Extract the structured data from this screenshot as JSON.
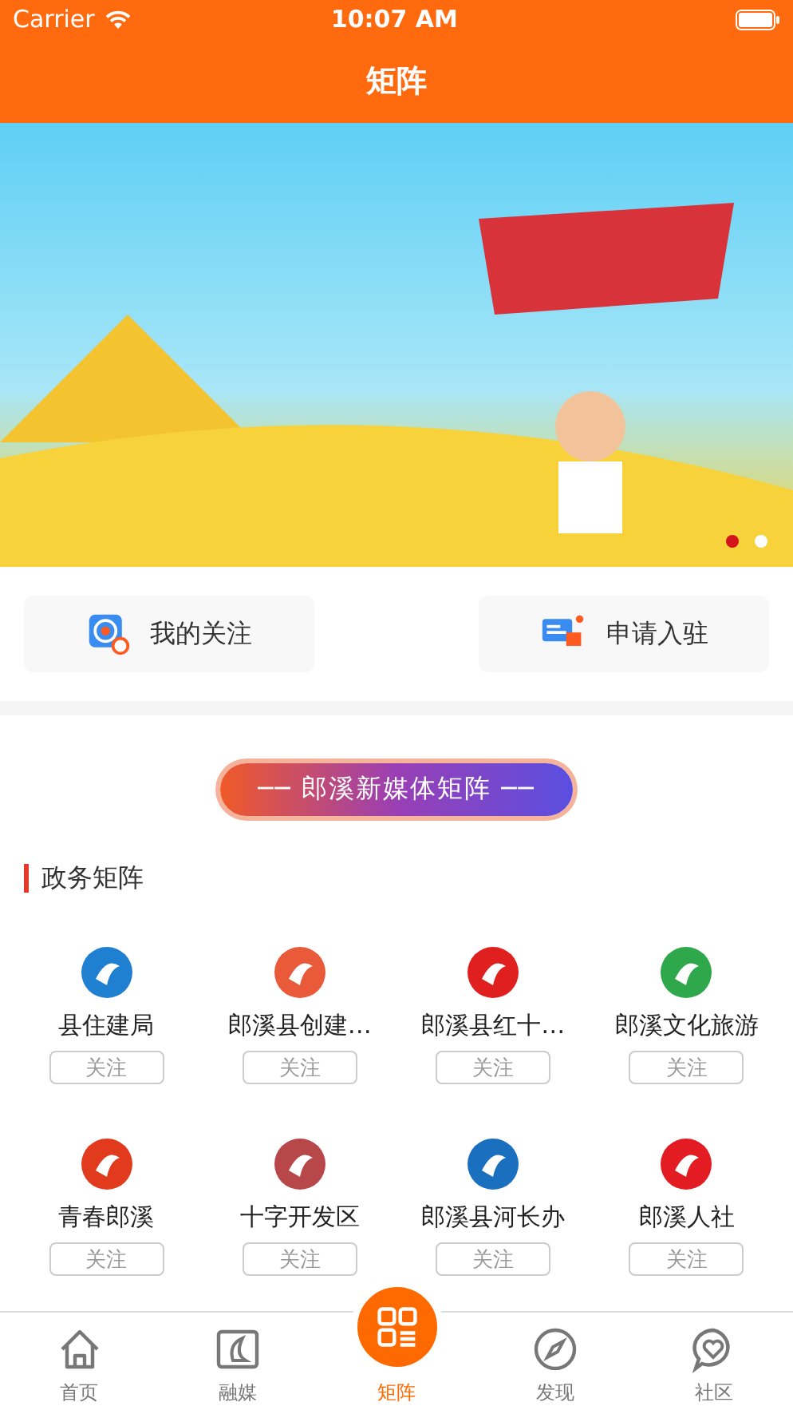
{
  "status_bar": {
    "carrier": "Carrier",
    "time": "10:07 AM"
  },
  "nav": {
    "title": "矩阵"
  },
  "banner": {
    "dots": [
      {
        "selected": true
      },
      {
        "selected": false
      }
    ]
  },
  "shortcuts": [
    {
      "kind": "follow",
      "label": "我的关注"
    },
    {
      "kind": "apply",
      "label": "申请入驻"
    }
  ],
  "section_banner": "── 郎溪新媒体矩阵 ──",
  "section_title": "政务矩阵",
  "accounts": [
    {
      "name": "县住建局",
      "color": "#1f7fd0",
      "follow": "关注"
    },
    {
      "name": "郎溪县创建…",
      "color": "#e85a3a",
      "follow": "关注"
    },
    {
      "name": "郎溪县红十…",
      "color": "#e0201f",
      "follow": "关注"
    },
    {
      "name": "郎溪文化旅游",
      "color": "#2ea84a",
      "follow": "关注"
    },
    {
      "name": "青春郎溪",
      "color": "#e23a1c",
      "follow": "关注"
    },
    {
      "name": "十字开发区",
      "color": "#b8474a",
      "follow": "关注"
    },
    {
      "name": "郎溪县河长办",
      "color": "#1a6fbf",
      "follow": "关注"
    },
    {
      "name": "郎溪人社",
      "color": "#e31c23",
      "follow": "关注"
    }
  ],
  "tabs": [
    {
      "kind": "home",
      "label": "首页",
      "selected": false
    },
    {
      "kind": "media",
      "label": "融媒",
      "selected": false
    },
    {
      "kind": "matrix",
      "label": "矩阵",
      "selected": true
    },
    {
      "kind": "discover",
      "label": "发现",
      "selected": false
    },
    {
      "kind": "community",
      "label": "社区",
      "selected": false
    }
  ]
}
